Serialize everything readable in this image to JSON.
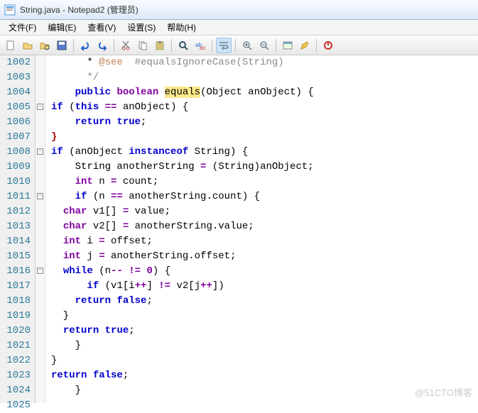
{
  "window": {
    "title": "String.java - Notepad2 (管理员)"
  },
  "menu": {
    "file": "文件(F)",
    "edit": "编辑(E)",
    "view": "查看(V)",
    "settings": "设置(S)",
    "help": "帮助(H)"
  },
  "toolbar_icons": [
    "new",
    "open",
    "browse",
    "save",
    "undo",
    "redo",
    "cut",
    "copy",
    "paste",
    "find",
    "replace",
    "wordwrap",
    "zoomin",
    "zoomout",
    "scheme",
    "inspect",
    "onoff"
  ],
  "gutter_start": 1002,
  "gutter_count": 24,
  "fold_rows": {
    "1005": "-",
    "1008": "-",
    "1011": "-",
    "1016": "-"
  },
  "code_lines": [
    {
      "t": "      * <span class='ann'>@see</span>  <span class='cmt'>#equalsIgnoreCase(String)</span>"
    },
    {
      "t": "      <span class='cmt'>*/</span>"
    },
    {
      "t": "    <span class='kw'>public</span> <span class='type'>boolean</span> <span class='hl'>equals</span>(Object anObject) {"
    },
    {
      "t": "<span class='kw'>if</span> (<span class='kw'>this</span> <span class='op'>==</span> anObject) {"
    },
    {
      "t": "    <span class='kw'>return</span> <span class='kw'>true</span>;"
    },
    {
      "t": "<span class='brace'>}</span>"
    },
    {
      "t": "<span class='kw'>if</span> (anObject <span class='kw'>instanceof</span> String) {"
    },
    {
      "t": "    String anotherString <span class='op'>=</span> (String)anObject;"
    },
    {
      "t": "    <span class='type'>int</span> n <span class='op'>=</span> count;"
    },
    {
      "t": "    <span class='kw'>if</span> (n <span class='op'>==</span> anotherString.count) {"
    },
    {
      "t": "  <span class='type'>char</span> v1[] <span class='op'>=</span> value;"
    },
    {
      "t": "  <span class='type'>char</span> v2[] <span class='op'>=</span> anotherString.value;"
    },
    {
      "t": "  <span class='type'>int</span> i <span class='op'>=</span> offset;"
    },
    {
      "t": "  <span class='type'>int</span> j <span class='op'>=</span> anotherString.offset;"
    },
    {
      "t": "  <span class='kw'>while</span> (n<span class='op'>--</span> <span class='op'>!=</span> <span class='op'>0</span>) {"
    },
    {
      "t": "      <span class='kw'>if</span> (v1[i<span class='op'>++</span>] <span class='op'>!=</span> v2[j<span class='op'>++</span>])"
    },
    {
      "t": "    <span class='kw'>return</span> <span class='kw'>false</span>;"
    },
    {
      "t": "  }"
    },
    {
      "t": "  <span class='kw'>return</span> <span class='kw'>true</span>;"
    },
    {
      "t": "    }"
    },
    {
      "t": "}"
    },
    {
      "t": "<span class='kw'>return</span> <span class='kw'>false</span>;"
    },
    {
      "t": "    }"
    },
    {
      "t": ""
    }
  ],
  "watermark": "@51CTO博客"
}
